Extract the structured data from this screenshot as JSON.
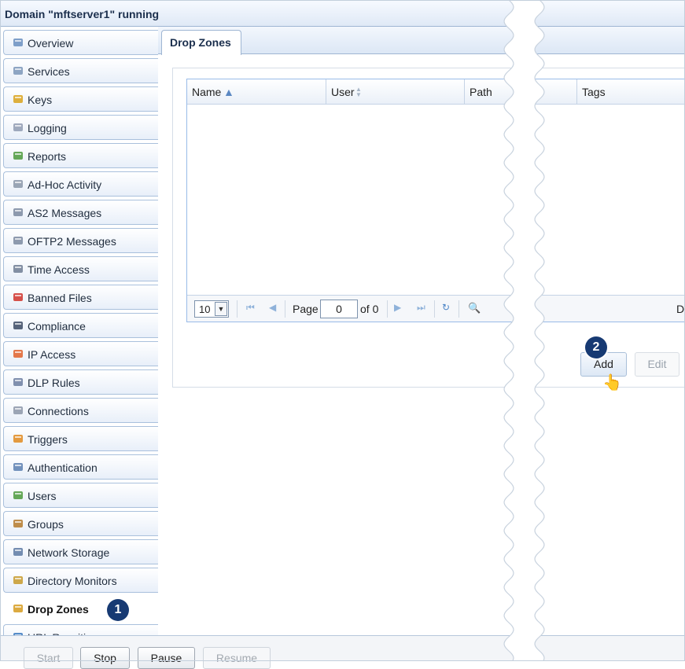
{
  "title": "Domain \"mftserver1\" running",
  "sidebar": {
    "items": [
      {
        "label": "Overview",
        "icon": "overview-icon",
        "color": "#6a8fbf"
      },
      {
        "label": "Services",
        "icon": "services-icon",
        "color": "#7b96b8"
      },
      {
        "label": "Keys",
        "icon": "key-icon",
        "color": "#d9a21b"
      },
      {
        "label": "Logging",
        "icon": "speech-bubble-icon",
        "color": "#8f9bb1"
      },
      {
        "label": "Reports",
        "icon": "bar-chart-icon",
        "color": "#4c9a3b"
      },
      {
        "label": "Ad-Hoc Activity",
        "icon": "envelope-icon",
        "color": "#8a96a8"
      },
      {
        "label": "AS2 Messages",
        "icon": "messages-icon",
        "color": "#7b8aa0"
      },
      {
        "label": "OFTP2 Messages",
        "icon": "messages-icon",
        "color": "#7b8aa0"
      },
      {
        "label": "Time Access",
        "icon": "calendar-clock-icon",
        "color": "#6e7d93"
      },
      {
        "label": "Banned Files",
        "icon": "banned-file-icon",
        "color": "#d0322a"
      },
      {
        "label": "Compliance",
        "icon": "person-icon",
        "color": "#3c4a63"
      },
      {
        "label": "IP Access",
        "icon": "firewall-icon",
        "color": "#e0622a"
      },
      {
        "label": "DLP Rules",
        "icon": "shield-icon",
        "color": "#6c7ea0"
      },
      {
        "label": "Connections",
        "icon": "gears-icon",
        "color": "#8c97a8"
      },
      {
        "label": "Triggers",
        "icon": "trigger-icon",
        "color": "#e08a1e"
      },
      {
        "label": "Authentication",
        "icon": "id-card-icon",
        "color": "#5a7fb0"
      },
      {
        "label": "Users",
        "icon": "user-icon",
        "color": "#4c9a3b"
      },
      {
        "label": "Groups",
        "icon": "group-icon",
        "color": "#b57a2a"
      },
      {
        "label": "Network Storage",
        "icon": "network-storage-icon",
        "color": "#5d7aa3"
      },
      {
        "label": "Directory Monitors",
        "icon": "directory-monitor-icon",
        "color": "#c79a2a"
      },
      {
        "label": "Drop Zones",
        "icon": "box-icon",
        "color": "#d69b1e",
        "active": true
      },
      {
        "label": "URL Rewriting",
        "icon": "globe-icon",
        "color": "#3a7ac0"
      }
    ]
  },
  "callouts": {
    "step1": "1",
    "step2": "2"
  },
  "tabs": [
    {
      "label": "Drop Zones"
    }
  ],
  "grid": {
    "columns": [
      {
        "label": "Name",
        "sort": "asc"
      },
      {
        "label": "User",
        "sort": "none"
      },
      {
        "label": "Path",
        "sort": ""
      },
      {
        "label": "Tags",
        "sort": ""
      }
    ],
    "rows": []
  },
  "pager": {
    "page_size": "10",
    "page_label": "Page",
    "page_value": "0",
    "of_label": "of 0",
    "status_text": "D"
  },
  "actions": {
    "add": "Add",
    "edit": "Edit"
  },
  "bottom": {
    "start": "Start",
    "stop": "Stop",
    "pause": "Pause",
    "resume": "Resume"
  }
}
